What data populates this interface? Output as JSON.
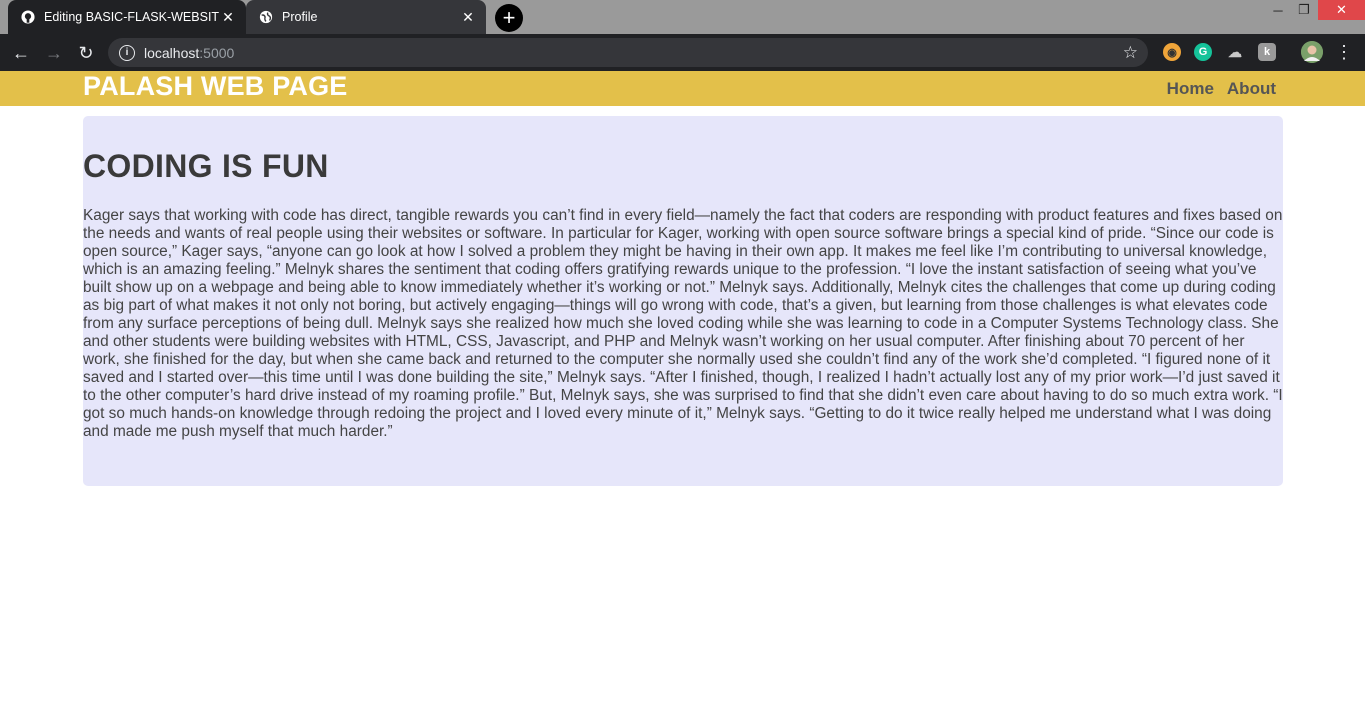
{
  "browser": {
    "tabs": [
      {
        "title": "Editing BASIC-FLASK-WEBSITE/README",
        "icon": "github-icon",
        "active": true
      },
      {
        "title": "Profile",
        "icon": "globe-icon",
        "active": false
      }
    ],
    "address": {
      "host": "localhost",
      "port": ":5000"
    },
    "extensions": [
      "owl-extension-icon",
      "grammarly-icon",
      "cloud-extension-icon",
      "keyboard-extension-icon",
      "avatar"
    ]
  },
  "site": {
    "brand": "PALASH WEB PAGE",
    "nav": [
      "Home",
      "About"
    ],
    "colors": {
      "navbar": "#e3c04a",
      "content_bg": "#e6e6fa"
    }
  },
  "article": {
    "heading": "CODING IS FUN",
    "body": "Kager says that working with code has direct, tangible rewards you can’t find in every field—namely the fact that coders are responding with product features and fixes based on the needs and wants of real people using their websites or software. In particular for Kager, working with open source software brings a special kind of pride. “Since our code is open source,” Kager says, “anyone can go look at how I solved a problem they might be having in their own app. It makes me feel like I’m contributing to universal knowledge, which is an amazing feeling.” Melnyk shares the sentiment that coding offers gratifying rewards unique to the profession. “I love the instant satisfaction of seeing what you’ve built show up on a webpage and being able to know immediately whether it’s working or not.” Melnyk says. Additionally, Melnyk cites the challenges that come up during coding as big part of what makes it not only not boring, but actively engaging—things will go wrong with code, that’s a given, but learning from those challenges is what elevates code from any surface perceptions of being dull. Melnyk says she realized how much she loved coding while she was learning to code in a Computer Systems Technology class. She and other students were building websites with HTML, CSS, Javascript, and PHP and Melnyk wasn’t working on her usual computer. After finishing about 70 percent of her work, she finished for the day, but when she came back and returned to the computer she normally used she couldn’t find any of the work she’d completed. “I figured none of it saved and I started over—this time until I was done building the site,” Melnyk says. “After I finished, though, I realized I hadn’t actually lost any of my prior work—I’d just saved it to the other computer’s hard drive instead of my roaming profile.” But, Melnyk says, she was surprised to find that she didn’t even care about having to do so much extra work. “I got so much hands-on knowledge through redoing the project and I loved every minute of it,” Melnyk says. “Getting to do it twice really helped me understand what I was doing and made me push myself that much harder.”"
  }
}
